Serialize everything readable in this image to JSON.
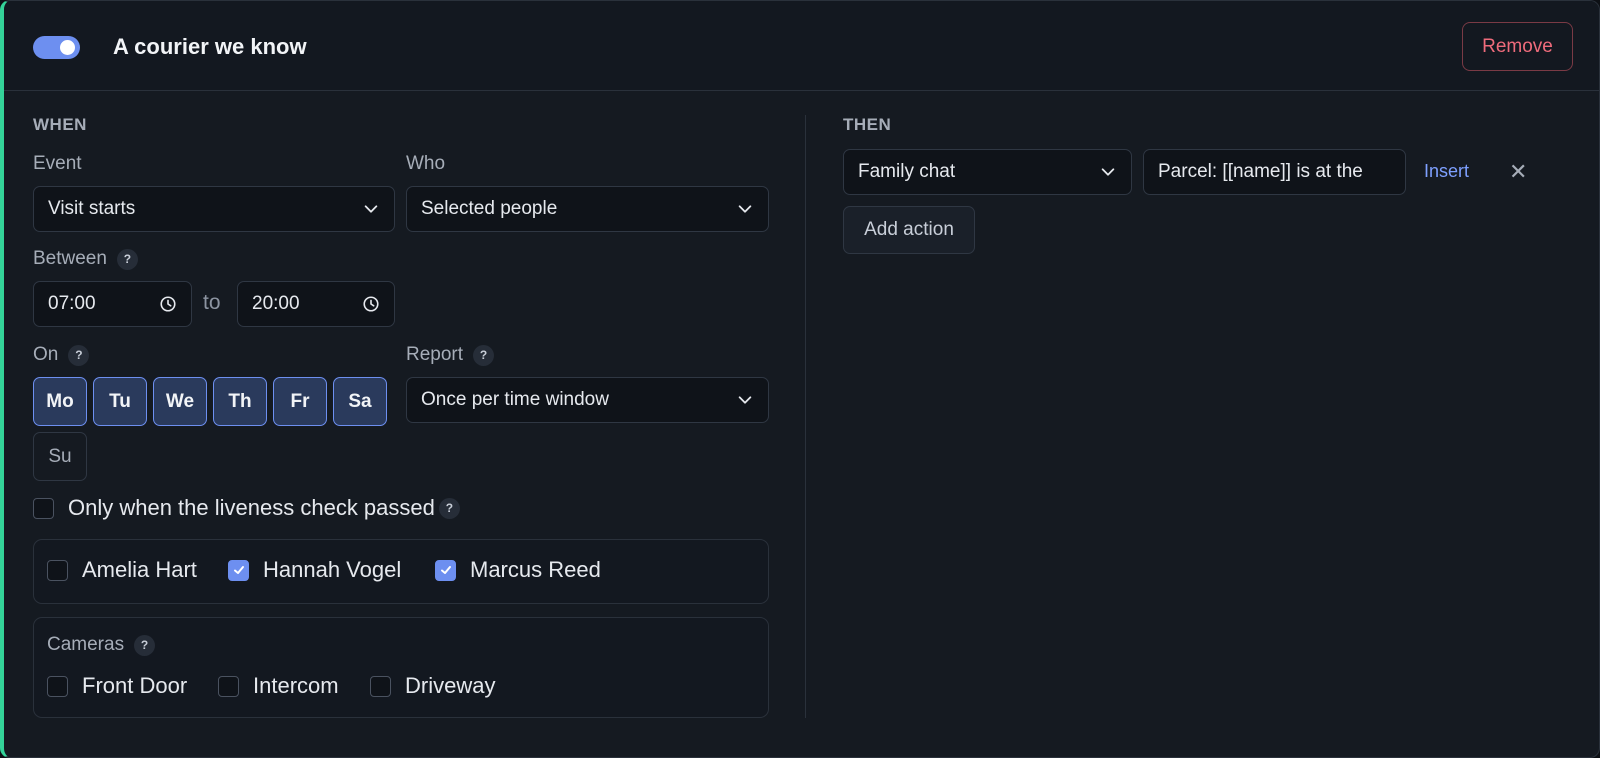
{
  "rule": {
    "enabled": true,
    "title": "A courier we know",
    "remove_label": "Remove"
  },
  "when": {
    "heading": "WHEN",
    "event": {
      "label": "Event",
      "value": "Visit starts"
    },
    "who": {
      "label": "Who",
      "value": "Selected people"
    },
    "between": {
      "label": "Between",
      "help": "?",
      "from": "07:00",
      "to_label": "to",
      "to": "20:00"
    },
    "on": {
      "label": "On",
      "help": "?",
      "days": [
        {
          "label": "Mo",
          "selected": true
        },
        {
          "label": "Tu",
          "selected": true
        },
        {
          "label": "We",
          "selected": true
        },
        {
          "label": "Th",
          "selected": true
        },
        {
          "label": "Fr",
          "selected": true
        },
        {
          "label": "Sa",
          "selected": true
        },
        {
          "label": "Su",
          "selected": false
        }
      ]
    },
    "report": {
      "label": "Report",
      "help": "?",
      "value": "Once per time window"
    },
    "liveness": {
      "label": "Only when the liveness check passed",
      "help": "?",
      "checked": false
    },
    "people": [
      {
        "name": "Amelia Hart",
        "checked": false
      },
      {
        "name": "Hannah Vogel",
        "checked": true
      },
      {
        "name": "Marcus Reed",
        "checked": true
      }
    ],
    "cameras": {
      "label": "Cameras",
      "help": "?",
      "items": [
        {
          "name": "Front Door",
          "checked": false
        },
        {
          "name": "Intercom",
          "checked": false
        },
        {
          "name": "Driveway",
          "checked": false
        }
      ]
    }
  },
  "then": {
    "heading": "THEN",
    "action": {
      "target": "Family chat",
      "message": "Parcel: [[name]] is at the",
      "insert_label": "Insert",
      "remove_symbol": "✕"
    },
    "add_action_label": "Add action"
  },
  "colors": {
    "accent": "#6d8ff0",
    "left_stripe": "#34d399",
    "danger": "#ef6b7b",
    "link": "#7ea0ff"
  }
}
